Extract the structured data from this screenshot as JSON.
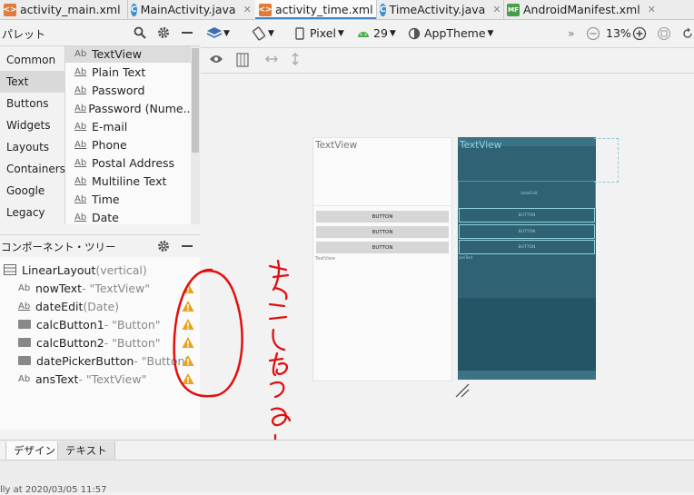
{
  "tabs": [
    {
      "label": "activity_main.xml",
      "icon": "xml-file-icon",
      "active": false
    },
    {
      "label": "MainActivity.java",
      "icon": "java-class-icon",
      "active": false
    },
    {
      "label": "activity_time.xml",
      "icon": "xml-file-icon",
      "active": true
    },
    {
      "label": "TimeActivity.java",
      "icon": "java-class-icon",
      "active": false
    },
    {
      "label": "AndroidManifest.xml",
      "icon": "manifest-file-icon",
      "active": false
    }
  ],
  "palette": {
    "title": "パレット",
    "categories": [
      "Common",
      "Text",
      "Buttons",
      "Widgets",
      "Layouts",
      "Containers",
      "Google",
      "Legacy"
    ],
    "selected_category": "Text",
    "widgets": [
      "TextView",
      "Plain Text",
      "Password",
      "Password (Nume...",
      "E-mail",
      "Phone",
      "Postal Address",
      "Multiline Text",
      "Time",
      "Date"
    ],
    "widget_icon_text": "Ab"
  },
  "component_tree": {
    "title": "コンポーネント・ツリー",
    "root": {
      "name": "LinearLayout",
      "detail": "(vertical)"
    },
    "children": [
      {
        "name": "nowText",
        "detail": "- \"TextView\"",
        "type": "text"
      },
      {
        "name": "dateEdit",
        "detail": "(Date)",
        "type": "edit"
      },
      {
        "name": "calcButton1",
        "detail": "- \"Button\"",
        "type": "button"
      },
      {
        "name": "calcButton2",
        "detail": "- \"Button\"",
        "type": "button"
      },
      {
        "name": "datePickerButton",
        "detail": "- \"Button\"",
        "type": "button"
      },
      {
        "name": "ansText",
        "detail": "- \"TextView\"",
        "type": "text"
      }
    ]
  },
  "toolbar": {
    "device": "Pixel",
    "api": "29",
    "theme": "AppTheme",
    "zoom": "13%",
    "more": "»"
  },
  "design": {
    "textview_top": "TextView",
    "buttons": [
      "BUTTON",
      "BUTTON",
      "BUTTON"
    ],
    "textview_bottom": "TextView",
    "blueprint_textview": "TextView",
    "blueprint_date": "dateEdit",
    "blueprint_buttons": [
      "BUTTON",
      "BUTTON",
      "BUTTON"
    ],
    "blueprint_bottom": "ansText"
  },
  "bottom_tabs": [
    "デザイン",
    "テキスト"
  ],
  "status": "lly at 2020/03/05 11:57",
  "colors": {
    "accent": "#4083c9",
    "blueprint": "#2f6272",
    "blueprint_dark": "#245565",
    "warning": "#e8a317",
    "annotation": "#e01010"
  }
}
